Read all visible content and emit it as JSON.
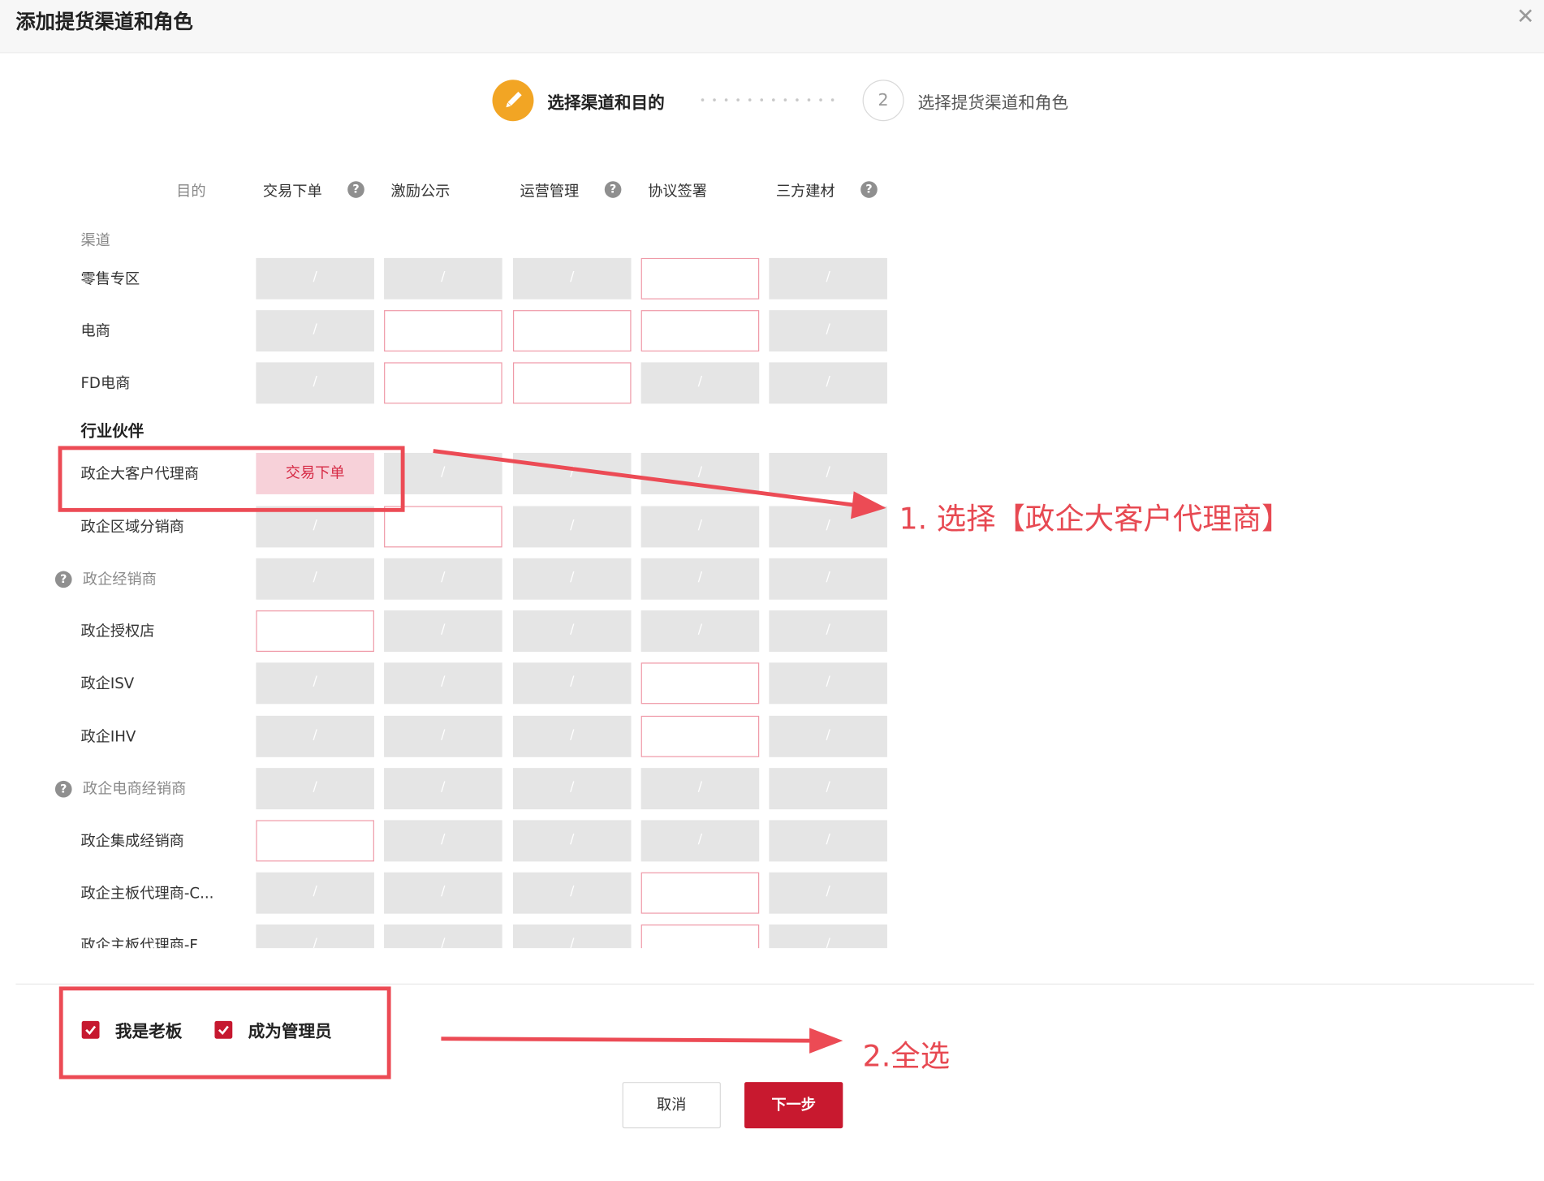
{
  "dialog": {
    "title": "添加提货渠道和角色",
    "close_glyph": "✕"
  },
  "steps": [
    {
      "index": "1",
      "label": "选择渠道和目的",
      "state": "active",
      "icon": "pencil-icon"
    },
    {
      "index": "2",
      "label": "选择提货渠道和角色",
      "state": "pending"
    }
  ],
  "table": {
    "purpose_header": "目的",
    "columns": [
      {
        "label": "交易下单",
        "help": true
      },
      {
        "label": "激励公示",
        "help": false
      },
      {
        "label": "运营管理",
        "help": true
      },
      {
        "label": "协议签署",
        "help": false
      },
      {
        "label": "三方建材",
        "help": true
      }
    ],
    "section_channel": "渠道",
    "disabled_glyph": "/",
    "help_glyph": "?",
    "rows": [
      {
        "label": "零售专区",
        "disabled": false,
        "help": false,
        "cells": [
          "disabled",
          "disabled",
          "disabled",
          "empty",
          "disabled"
        ]
      },
      {
        "label": "电商",
        "disabled": false,
        "help": false,
        "cells": [
          "disabled",
          "empty",
          "empty",
          "empty",
          "disabled"
        ]
      },
      {
        "label": "FD电商",
        "disabled": false,
        "help": false,
        "cells": [
          "disabled",
          "empty",
          "empty",
          "disabled",
          "disabled"
        ]
      },
      {
        "group": "行业伙伴"
      },
      {
        "label": "政企大客户代理商",
        "disabled": false,
        "help": false,
        "cells": [
          "selected",
          "disabled",
          "disabled",
          "disabled",
          "disabled"
        ],
        "selected_text": "交易下单"
      },
      {
        "label": "政企区域分销商",
        "disabled": false,
        "help": false,
        "cells": [
          "disabled",
          "empty",
          "disabled",
          "disabled",
          "disabled"
        ]
      },
      {
        "label": "政企经销商",
        "disabled": true,
        "help": true,
        "cells": [
          "disabled",
          "disabled",
          "disabled",
          "disabled",
          "disabled"
        ]
      },
      {
        "label": "政企授权店",
        "disabled": false,
        "help": false,
        "cells": [
          "empty",
          "disabled",
          "disabled",
          "disabled",
          "disabled"
        ]
      },
      {
        "label": "政企ISV",
        "disabled": false,
        "help": false,
        "cells": [
          "disabled",
          "disabled",
          "disabled",
          "empty",
          "disabled"
        ]
      },
      {
        "label": "政企IHV",
        "disabled": false,
        "help": false,
        "cells": [
          "disabled",
          "disabled",
          "disabled",
          "empty",
          "disabled"
        ]
      },
      {
        "label": "政企电商经销商",
        "disabled": true,
        "help": true,
        "cells": [
          "disabled",
          "disabled",
          "disabled",
          "disabled",
          "disabled"
        ]
      },
      {
        "label": "政企集成经销商",
        "disabled": false,
        "help": false,
        "cells": [
          "empty",
          "disabled",
          "disabled",
          "disabled",
          "disabled"
        ]
      },
      {
        "label": "政企主板代理商-C...",
        "disabled": false,
        "help": false,
        "cells": [
          "disabled",
          "disabled",
          "disabled",
          "empty",
          "disabled"
        ]
      },
      {
        "label": "政企主板代理商-F",
        "disabled": false,
        "help": false,
        "cells": [
          "disabled",
          "disabled",
          "disabled",
          "empty",
          "disabled"
        ]
      }
    ]
  },
  "checkboxes": [
    {
      "label": "我是老板",
      "checked": true
    },
    {
      "label": "成为管理员",
      "checked": true
    }
  ],
  "buttons": {
    "cancel": "取消",
    "next": "下一步"
  },
  "annotations": {
    "step1": "1. 选择【政企大客户代理商】",
    "step2": "2.全选",
    "color": "#e74952"
  },
  "colors": {
    "primary": "#c8192f",
    "step_active": "#f2a524",
    "cell_disabled": "#e5e5e5",
    "cell_selected": "#f7d1d9",
    "cell_border": "#ef9aa8"
  }
}
